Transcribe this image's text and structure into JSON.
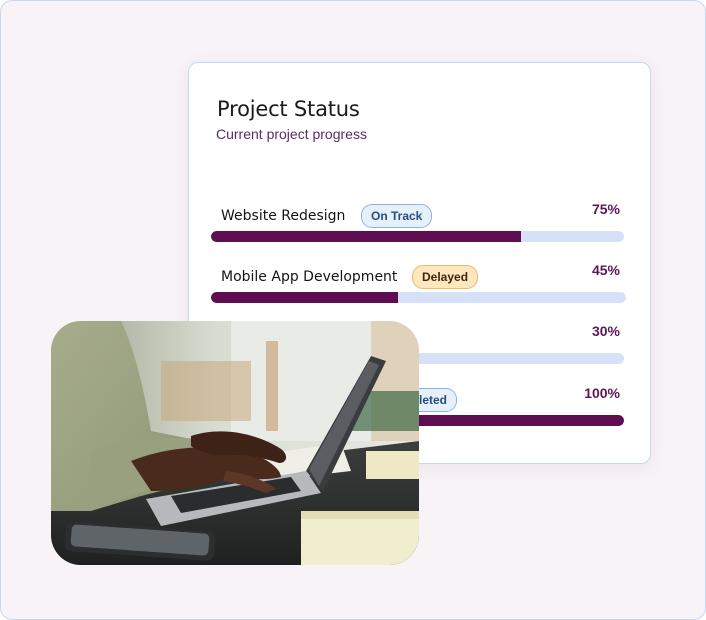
{
  "card": {
    "title": "Project Status",
    "subtitle": "Current project progress"
  },
  "projects": [
    {
      "name": "Website Redesign",
      "status": "On Track",
      "percent_label": "75%",
      "progress": 0.75
    },
    {
      "name": "Mobile App Development",
      "status": "Delayed",
      "percent_label": "45%",
      "progress": 0.45
    },
    {
      "name": "",
      "status": "",
      "percent_label": "30%",
      "progress": 0.3
    },
    {
      "name": "",
      "status": "Completed",
      "percent_label": "100%",
      "progress": 1.0
    }
  ],
  "colors": {
    "accent": "#5e0e50",
    "track": "#d6e1f7",
    "badge_blue_bg": "#e6f0fb",
    "badge_amber_bg": "#fde7bf",
    "page_bg": "#f8f3f7"
  },
  "photo": {
    "description_icon": "laptop-typing-photo"
  }
}
